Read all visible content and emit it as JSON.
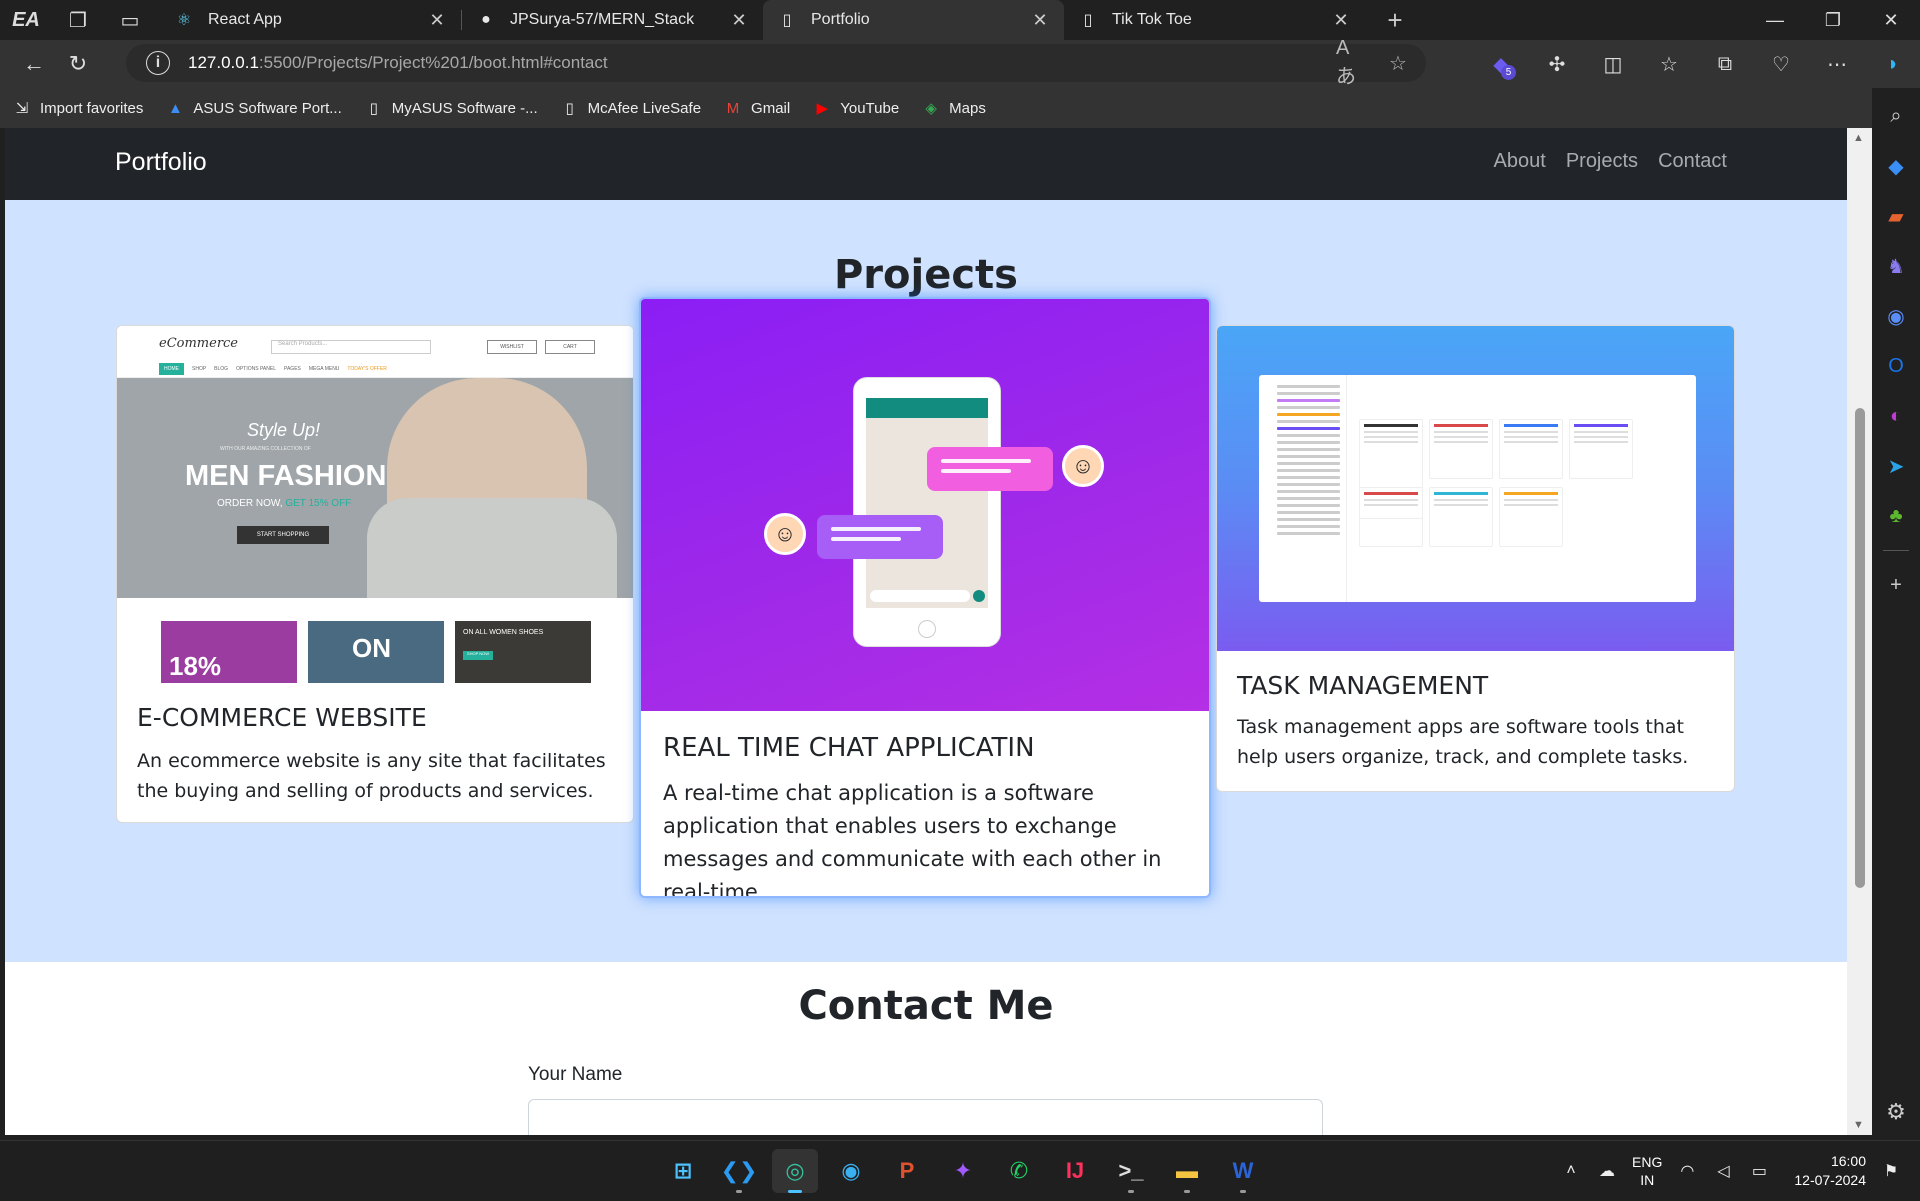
{
  "browser": {
    "profile_label": "EA",
    "tabs": [
      {
        "label": "React App",
        "icon": "react-icon",
        "active": false
      },
      {
        "label": "JPSurya-57/MERN_Stack",
        "icon": "github-icon",
        "active": false
      },
      {
        "label": "Portfolio",
        "icon": "page-icon",
        "active": true
      },
      {
        "label": "Tik Tok Toe",
        "icon": "page-icon",
        "active": false
      }
    ],
    "url_host": "127.0.0.1",
    "url_path": ":5500/Projects/Project%201/boot.html#contact",
    "extensions_badge": "5",
    "favorites": [
      {
        "label": "Import favorites",
        "icon": "import-icon",
        "color": "#dddddd"
      },
      {
        "label": "ASUS Software Port...",
        "icon": "asus-icon",
        "color": "#3a8ef6"
      },
      {
        "label": "MyASUS Software -...",
        "icon": "page-icon",
        "color": "#dddddd"
      },
      {
        "label": "McAfee LiveSafe",
        "icon": "page-icon",
        "color": "#dddddd"
      },
      {
        "label": "Gmail",
        "icon": "gmail-icon",
        "color": "#ea4335"
      },
      {
        "label": "YouTube",
        "icon": "youtube-icon",
        "color": "#ff0000"
      },
      {
        "label": "Maps",
        "icon": "maps-icon",
        "color": "#34a853"
      }
    ]
  },
  "site": {
    "brand": "Portfolio",
    "nav": [
      "About",
      "Projects",
      "Contact"
    ],
    "projects_title": "Projects",
    "cards": [
      {
        "title": "E-COMMERCE WEBSITE",
        "text": "An ecommerce website is any site that facilitates the buying and selling of products and services."
      },
      {
        "title": "REAL TIME CHAT APPLICATIN",
        "text": "A real-time chat application is a software application that enables users to exchange messages and communicate with each other in real-time."
      },
      {
        "title": "TASK MANAGEMENT",
        "text": "Task management apps are software tools that help users organize, track, and complete tasks."
      }
    ],
    "ecommerce_preview": {
      "logo": "eCommerce",
      "search": "Search Products...",
      "wishlist": "WISHLIST",
      "cart": "CART",
      "menu": [
        "HOME",
        "SHOP",
        "BLOG",
        "OPTIONS PANEL",
        "PAGES",
        "MEGA MENU",
        "TODAY'S OFFER"
      ],
      "hero_line1": "Style Up!",
      "hero_line2": "WITH OUR AMAZING COLLECTION OF",
      "hero_line3": "MEN FASHION",
      "hero_line4": "ORDER NOW,",
      "hero_offer": "GET 15% OFF",
      "hero_button": "START SHOPPING",
      "thumb1": "18%",
      "thumb2": "ON",
      "thumb3": "ON ALL WOMEN SHOES",
      "thumb3_btn": "SHOP NOW"
    },
    "contact_title": "Contact Me",
    "name_label": "Your Name",
    "name_value": ""
  },
  "taskbar": {
    "lang_top": "ENG",
    "lang_bottom": "IN",
    "time": "16:00",
    "date": "12-07-2024"
  },
  "colors": {
    "navbar": "#212529",
    "projects_bg": "#cfe2ff",
    "accent": "#0d6efd"
  }
}
